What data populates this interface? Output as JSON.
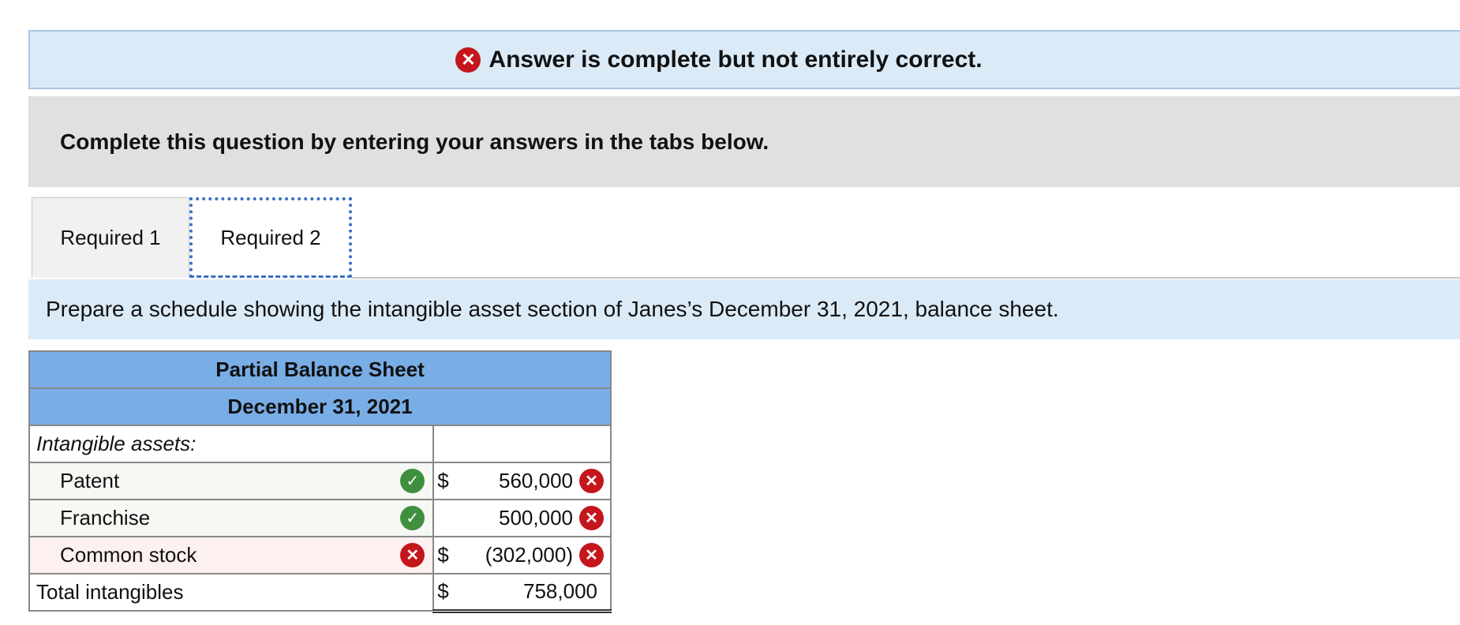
{
  "banner": {
    "text": "Answer is complete but not entirely correct."
  },
  "instruction": {
    "text": "Complete this question by entering your answers in the tabs below."
  },
  "tabs": [
    {
      "label": "Required 1"
    },
    {
      "label": "Required 2"
    }
  ],
  "prompt": {
    "text": "Prepare a schedule showing the intangible asset section of Janes’s December 31, 2021, balance sheet."
  },
  "sheet": {
    "title": "Partial Balance Sheet",
    "date": "December 31, 2021",
    "section_label": "Intangible assets:",
    "rows": [
      {
        "label": "Patent",
        "label_status": "correct",
        "currency": "$",
        "amount": "560,000",
        "amount_status": "incorrect"
      },
      {
        "label": "Franchise",
        "label_status": "correct",
        "currency": "",
        "amount": "500,000",
        "amount_status": "incorrect"
      },
      {
        "label": "Common stock",
        "label_status": "incorrect",
        "currency": "$",
        "amount": "(302,000)",
        "amount_status": "incorrect"
      }
    ],
    "total": {
      "label": "Total intangibles",
      "currency": "$",
      "amount": "758,000"
    }
  },
  "colors": {
    "banner_bg": "#dbeaf7",
    "header_bg": "#79ade6",
    "error_red": "#c4161c",
    "correct_green": "#3f8f3f"
  }
}
